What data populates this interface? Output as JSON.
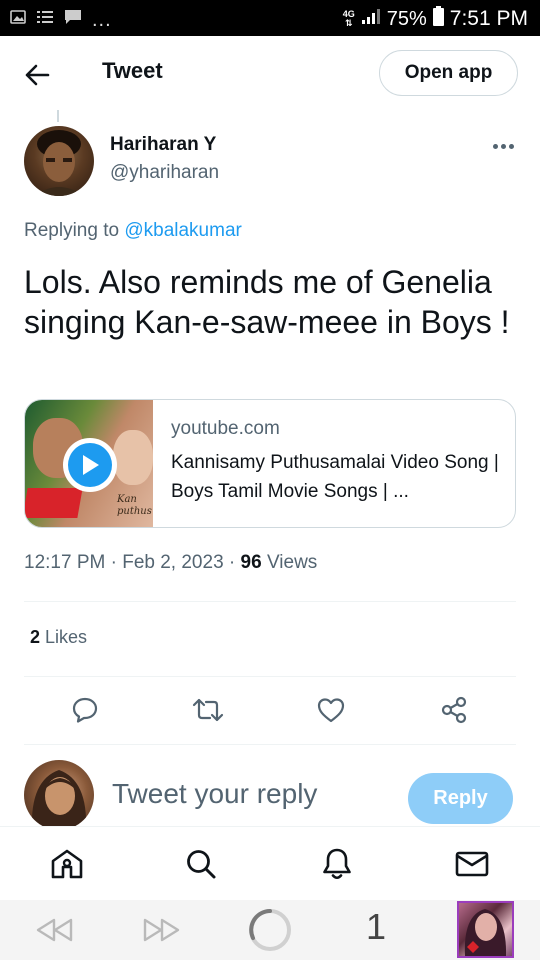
{
  "status_bar": {
    "network": "4G",
    "battery": "75%",
    "time": "7:51 PM",
    "overflow": "..."
  },
  "header": {
    "title": "Tweet",
    "open_app_label": "Open app"
  },
  "tweet": {
    "author_name": "Hariharan Y",
    "author_handle": "@yhariharan",
    "replying_prefix": "Replying to",
    "replying_to": "@kbalakumar",
    "text": "Lols. Also reminds me of Genelia singing Kan-e-saw-meee in Boys !",
    "card": {
      "domain": "youtube.com",
      "title": "Kannisamy Puthusamalai Video Song | Boys Tamil Movie Songs | ...",
      "thumb_text": [
        "Kan",
        "puthus"
      ]
    },
    "time": "12:17 PM",
    "date": "Feb 2, 2023",
    "views_count": "96",
    "views_label": "Views",
    "likes_count": "2",
    "likes_label": "Likes"
  },
  "actions": [
    "reply-icon",
    "retweet-icon",
    "like-icon",
    "share-icon"
  ],
  "composer": {
    "placeholder": "Tweet your reply",
    "reply_label": "Reply"
  },
  "bottom_nav": [
    "home-icon",
    "search-icon",
    "notifications-icon",
    "messages-icon"
  ],
  "browser_bar": {
    "tab_count": "1"
  },
  "colors": {
    "accent": "#1d9bf0",
    "reply_button": "#8ecdf8",
    "secondary_text": "#536471",
    "primary_text": "#0f1419"
  }
}
